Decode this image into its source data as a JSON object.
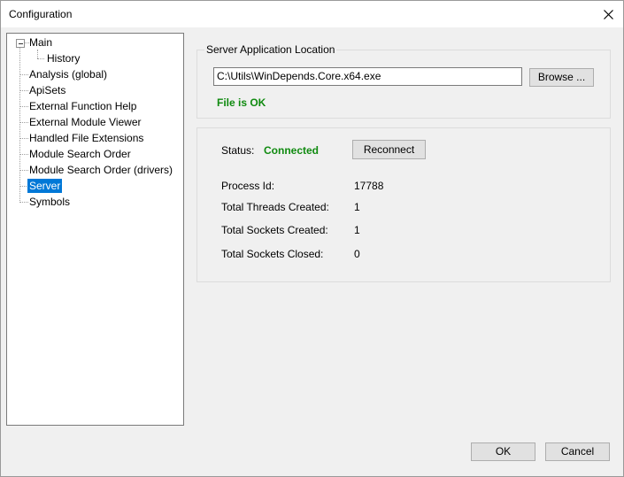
{
  "window": {
    "title": "Configuration"
  },
  "tree": {
    "items": [
      {
        "label": "Main"
      },
      {
        "label": "History"
      },
      {
        "label": "Analysis (global)"
      },
      {
        "label": "ApiSets"
      },
      {
        "label": "External Function Help"
      },
      {
        "label": "External Module Viewer"
      },
      {
        "label": "Handled File Extensions"
      },
      {
        "label": "Module Search Order"
      },
      {
        "label": "Module Search Order (drivers)"
      },
      {
        "label": "Server",
        "selected": true
      },
      {
        "label": "Symbols"
      }
    ]
  },
  "server_location": {
    "legend": "Server Application Location",
    "path_value": "C:\\Utils\\WinDepends.Core.x64.exe",
    "browse_label": "Browse ...",
    "file_status": "File is OK"
  },
  "status_panel": {
    "status_label": "Status:",
    "status_value": "Connected",
    "reconnect_label": "Reconnect",
    "rows": [
      {
        "label": "Process Id:",
        "value": "17788"
      },
      {
        "label": "Total Threads Created:",
        "value": "1"
      },
      {
        "label": "Total Sockets Created:",
        "value": "1"
      },
      {
        "label": "Total Sockets Closed:",
        "value": "0"
      }
    ]
  },
  "footer": {
    "ok_label": "OK",
    "cancel_label": "Cancel"
  },
  "colors": {
    "selection": "#0078d7",
    "ok_green": "#0f8a0f"
  }
}
